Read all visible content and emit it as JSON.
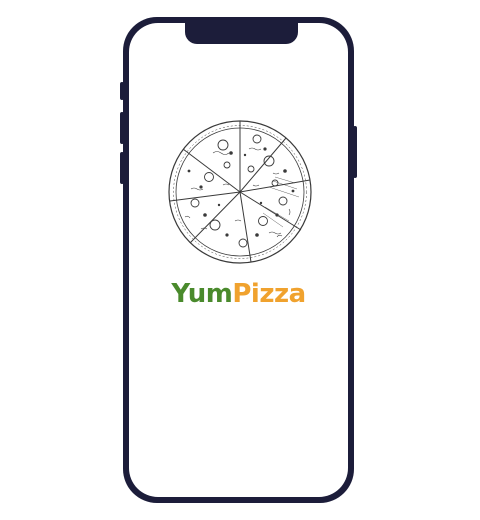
{
  "app": {
    "brand_part1": "Yum",
    "brand_part2": "Pizza"
  },
  "colors": {
    "phone_frame": "#1c1d3a",
    "screen_bg": "#ffffff",
    "brand_green": "#4a8a2c",
    "brand_orange": "#f0a22e",
    "sketch_ink": "#3a3a3a"
  },
  "icons": {
    "illustration": "pizza-sketch-icon"
  }
}
